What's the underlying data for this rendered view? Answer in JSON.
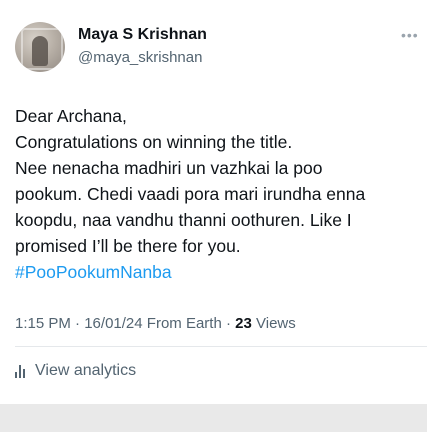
{
  "author": {
    "name": "Maya S Krishnan",
    "handle": "@maya_skrishnan"
  },
  "menu_icon": "more-options-icon",
  "tweet": {
    "lines": [
      "Dear Archana,",
      "Congratulations on winning the title.",
      "Nee nenacha madhiri un vazhkai la poo",
      "pookum. Chedi vaadi pora mari irundha enna",
      "koopdu, naa vandhu thanni oothuren. Like I",
      "promised I’ll be there for you."
    ],
    "hashtag": "#PooPookumNanba"
  },
  "meta": {
    "time": "1:15 PM",
    "date": "16/01/24",
    "source": "From Earth",
    "views_count": "23",
    "views_label": "Views"
  },
  "analytics": {
    "label": "View analytics",
    "icon": "analytics-bars-icon"
  },
  "colors": {
    "link": "#1d9bf0",
    "secondary_text": "#536471",
    "primary_text": "#0f1419"
  }
}
